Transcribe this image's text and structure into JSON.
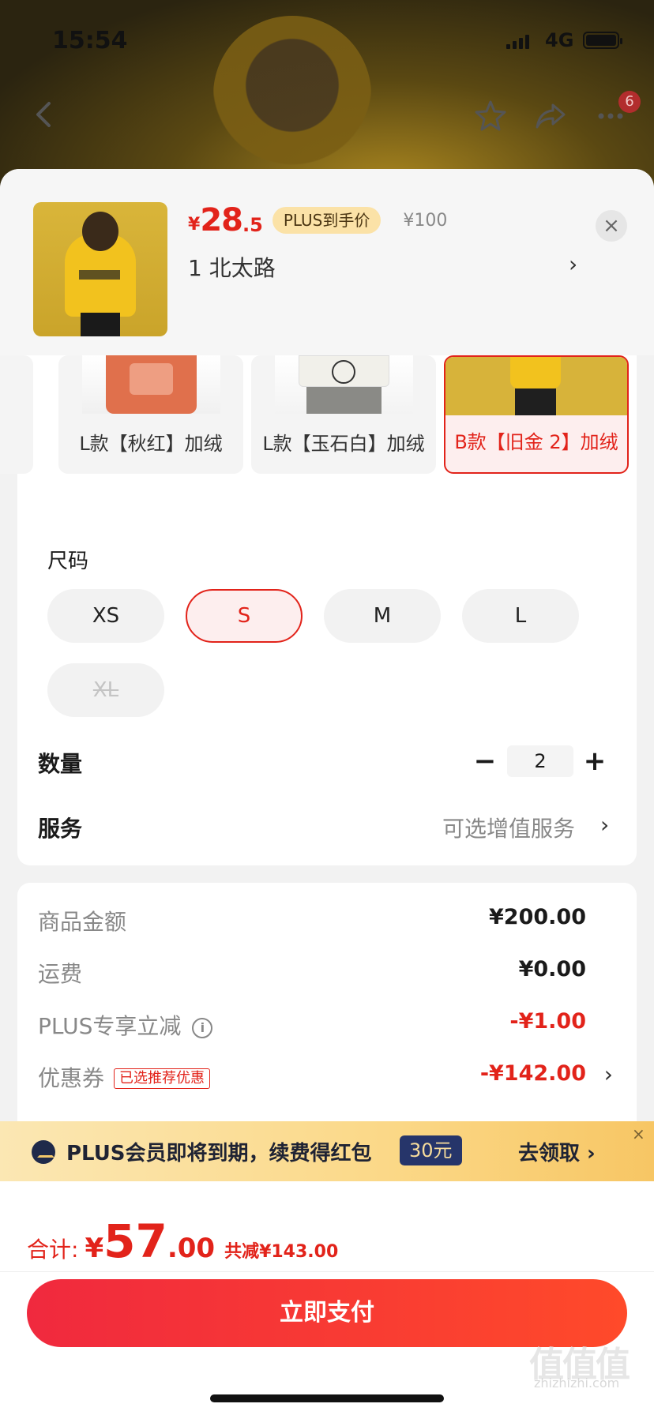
{
  "status_bar": {
    "time": "15:54",
    "network": "4G"
  },
  "nav": {
    "badge_count": "6"
  },
  "product": {
    "price_yen": "¥",
    "price_int": "28",
    "price_dec": ".5",
    "plus_tag": "PLUS到手价",
    "original_price": "¥100",
    "address": "1  北太路",
    "close": "×"
  },
  "styles": [
    {
      "label": "L款【秋红】加绒"
    },
    {
      "label": "L款【玉石白】加绒"
    },
    {
      "label": "B款【旧金 2】加绒",
      "selected": true
    }
  ],
  "size": {
    "title": "尺码",
    "options": [
      "XS",
      "S",
      "M",
      "L",
      "XL"
    ],
    "selected": "S",
    "disabled": [
      "XL"
    ]
  },
  "quantity": {
    "label": "数量",
    "value": "2",
    "minus": "−",
    "plus": "+"
  },
  "service": {
    "label": "服务",
    "value": "可选增值服务",
    "chevron": "›"
  },
  "details": {
    "goods_amount": {
      "label": "商品金额",
      "value": "¥200.00"
    },
    "shipping": {
      "label": "运费",
      "value": "¥0.00"
    },
    "plus_discount": {
      "label": "PLUS专享立减",
      "value": "-¥1.00"
    },
    "coupon": {
      "label": "优惠券",
      "tag": "已选推荐优惠",
      "value": "-¥142.00"
    }
  },
  "banner": {
    "text": "PLUS会员即将到期，续费得红包",
    "pill": "30元",
    "cta": "去领取 ›",
    "close": "×"
  },
  "total": {
    "label": "合计:",
    "yen": "¥",
    "int": "57",
    "dec": ".00",
    "saved": "共减¥143.00"
  },
  "pay_button": "立即支付",
  "watermark": {
    "logo": "值值值",
    "site": "zhizhizhi.com"
  },
  "colors": {
    "accent": "#e2231a",
    "plus_gold": "#fbe2a7",
    "plus_navy": "#26356a"
  }
}
